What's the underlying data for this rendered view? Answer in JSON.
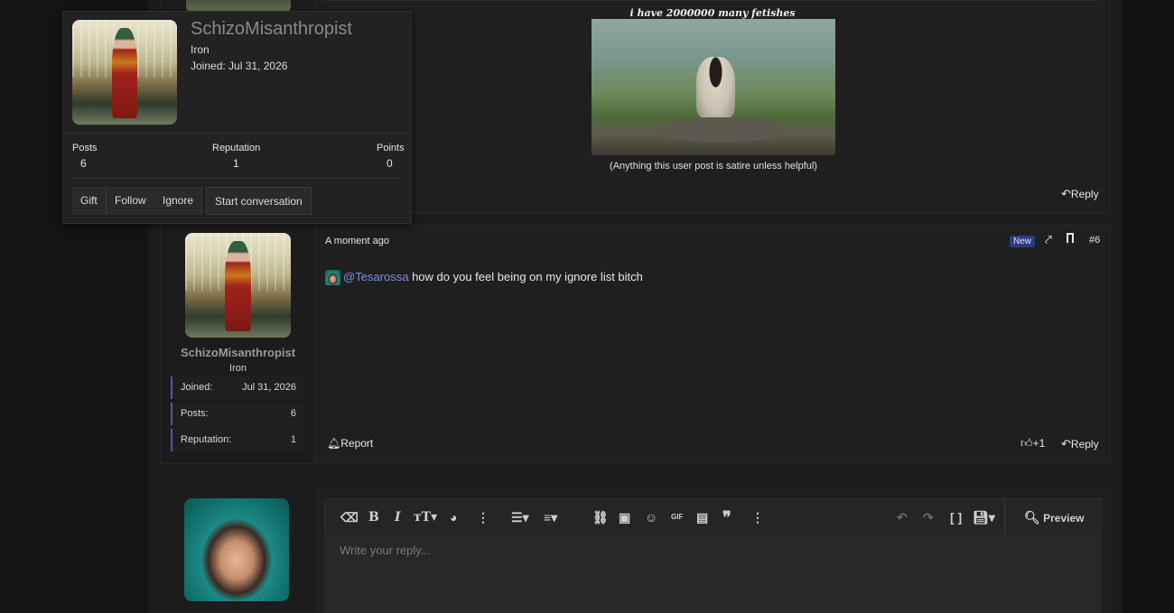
{
  "post5": {
    "signature_title": "i have 2000000 many fetishes",
    "signature_caption": "(Anything this user post is satire unless helpful)",
    "reply_label": "Reply"
  },
  "post6": {
    "timestamp": "A moment ago",
    "new_badge": "New",
    "post_number": "#6",
    "mention": "@Tesarossa",
    "body": "how do you feel being on my ignore list bitch",
    "report_label": "Report",
    "reaction_count": "+1",
    "reply_label": "Reply",
    "user": {
      "name": "SchizoMisanthropist",
      "rank": "Iron",
      "stats": [
        {
          "label": "Joined:",
          "value": "Jul 31, 2026"
        },
        {
          "label": "Posts:",
          "value": "6"
        },
        {
          "label": "Reputation:",
          "value": "1"
        }
      ]
    }
  },
  "tooltip": {
    "name": "SchizoMisanthropist",
    "rank": "Iron",
    "joined": "Joined: Jul 31, 2026",
    "stats": [
      {
        "label": "Posts",
        "value": "6"
      },
      {
        "label": "Reputation",
        "value": "1"
      },
      {
        "label": "Points",
        "value": "0"
      }
    ],
    "buttons": [
      "Gift",
      "Follow",
      "Ignore",
      "Start conversation"
    ]
  },
  "editor": {
    "placeholder": "Write your reply...",
    "preview_label": "Preview",
    "gif_label": "GIF"
  },
  "icons": [
    "reply-icon",
    "share-icon",
    "bookmark-icon",
    "bell-icon",
    "thumbs-up-icon",
    "eraser-icon",
    "bold-icon",
    "italic-icon",
    "text-size-icon",
    "palette-icon",
    "more-icon",
    "list-icon",
    "align-icon",
    "link-icon",
    "image-icon",
    "smiley-icon",
    "gif-icon",
    "media-icon",
    "quote-icon",
    "undo-icon",
    "redo-icon",
    "brackets-icon",
    "save-icon",
    "preview-icon"
  ],
  "colors": {
    "mention": "#7f8fe0",
    "new_badge_bg": "#2b3c7a",
    "stat_border": "#4a5aa8"
  }
}
